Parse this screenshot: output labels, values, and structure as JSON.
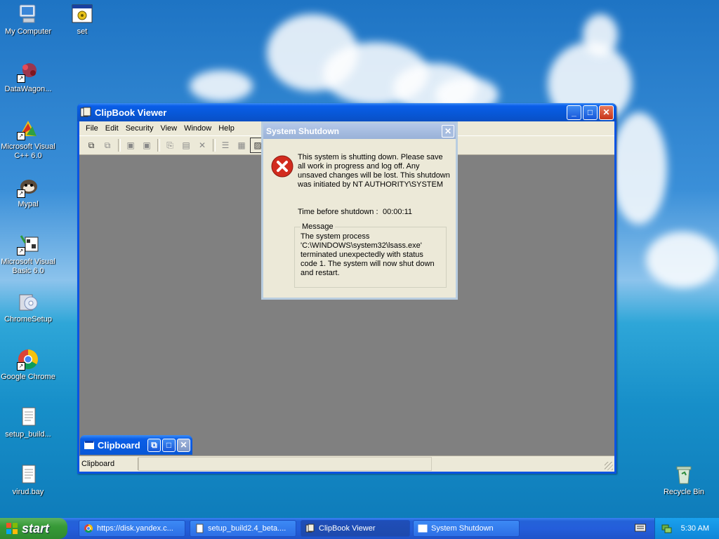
{
  "desktop": {
    "icons": [
      {
        "label": "My Computer"
      },
      {
        "label": "set"
      },
      {
        "label": "DataWagon..."
      },
      {
        "label": "Microsoft Visual C++ 6.0"
      },
      {
        "label": "Mypal"
      },
      {
        "label": "Microsoft Visual Basic 6.0"
      },
      {
        "label": "ChromeSetup"
      },
      {
        "label": "Google Chrome"
      },
      {
        "label": "setup_build..."
      },
      {
        "label": "virud.bay"
      },
      {
        "label": "Recycle Bin"
      }
    ]
  },
  "clipbook": {
    "title": "ClipBook Viewer",
    "menu": [
      "File",
      "Edit",
      "Security",
      "View",
      "Window",
      "Help"
    ],
    "child_title": "Clipboard",
    "status": "Clipboard"
  },
  "dialog": {
    "title": "System Shutdown",
    "body": "This system is shutting down. Please save all work in progress and log off. Any unsaved changes will be lost. This shutdown was initiated by NT AUTHORITY\\SYSTEM",
    "time_label": "Time before shutdown :",
    "time_value": "00:00:11",
    "message_legend": "Message",
    "message_text": "The system process 'C:\\WINDOWS\\system32\\lsass.exe' terminated unexpectedly with status code 1.  The system will now shut down and restart."
  },
  "taskbar": {
    "start_label": "start",
    "tasks": [
      {
        "label": "https://disk.yandex.c..."
      },
      {
        "label": "setup_build2.4_beta...."
      },
      {
        "label": "ClipBook Viewer"
      },
      {
        "label": "System Shutdown"
      }
    ],
    "clock": "5:30 AM"
  },
  "colors": {
    "xp_blue": "#0a54e2",
    "dialog_bg": "#ece9d8",
    "start_green": "#379a37",
    "error_red": "#d22b1e"
  }
}
